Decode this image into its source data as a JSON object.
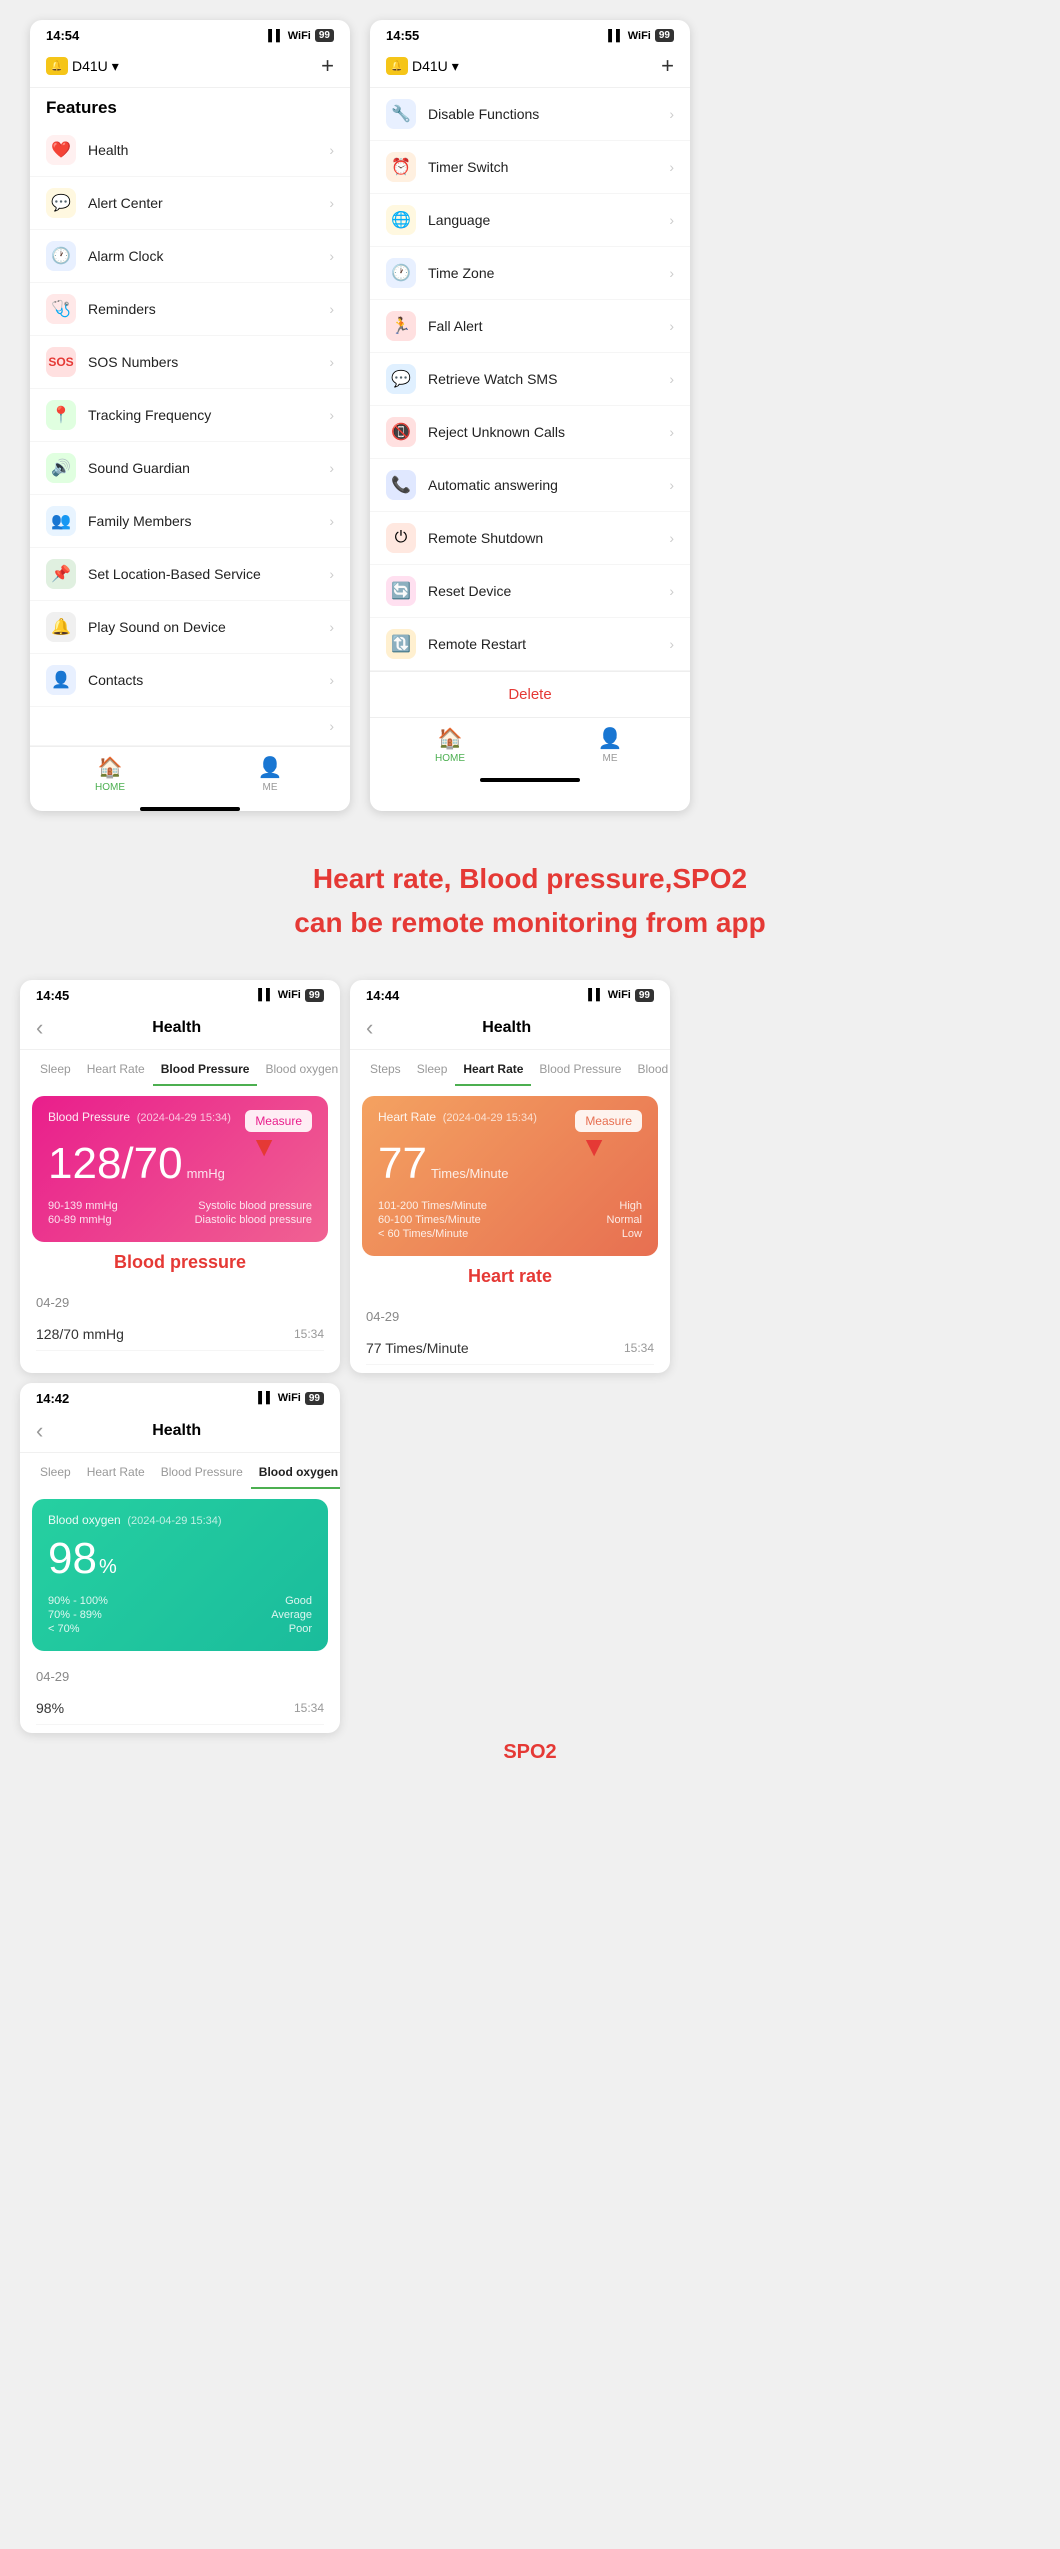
{
  "screen1": {
    "time": "14:54",
    "signal": "▌▌▌",
    "wifi": "WiFi",
    "battery": "99",
    "device": "D41U",
    "plus": "+",
    "features_title": "Features",
    "menu_items": [
      {
        "icon": "❤️",
        "icon_bg": "#fff0f0",
        "label": "Health"
      },
      {
        "icon": "💬",
        "icon_bg": "#fff8e0",
        "label": "Alert Center"
      },
      {
        "icon": "🕐",
        "icon_bg": "#e8f0ff",
        "label": "Alarm Clock"
      },
      {
        "icon": "🩺",
        "icon_bg": "#ffe8e8",
        "label": "Reminders"
      },
      {
        "icon": "🆘",
        "icon_bg": "#ffe0e0",
        "label": "SOS Numbers"
      },
      {
        "icon": "📍",
        "icon_bg": "#e0ffe0",
        "label": "Tracking Frequency"
      },
      {
        "icon": "🔊",
        "icon_bg": "#e0ffe0",
        "label": "Sound Guardian"
      },
      {
        "icon": "👨‍👩‍👧",
        "icon_bg": "#e8f4ff",
        "label": "Family Members"
      },
      {
        "icon": "📌",
        "icon_bg": "#e0f0e0",
        "label": "Set Location-Based Service"
      },
      {
        "icon": "🔔",
        "icon_bg": "#f0f0f0",
        "label": "Play Sound on Device"
      },
      {
        "icon": "👤",
        "icon_bg": "#e8f0ff",
        "label": "Contacts"
      },
      {
        "icon": "›",
        "icon_bg": "#fff",
        "label": ""
      }
    ],
    "tab_home": "HOME",
    "tab_me": "ME"
  },
  "screen2": {
    "time": "14:55",
    "signal": "▌▌▌",
    "wifi": "WiFi",
    "battery": "99",
    "device": "D41U",
    "plus": "+",
    "menu_items": [
      {
        "icon": "🔧",
        "icon_bg": "#e8f0ff",
        "label": "Disable Functions"
      },
      {
        "icon": "⏰",
        "icon_bg": "#fff0e0",
        "label": "Timer Switch"
      },
      {
        "icon": "🌐",
        "icon_bg": "#fff8e0",
        "label": "Language"
      },
      {
        "icon": "🕐",
        "icon_bg": "#e8f0ff",
        "label": "Time Zone"
      },
      {
        "icon": "🏃",
        "icon_bg": "#ffe0e0",
        "label": "Fall Alert"
      },
      {
        "icon": "💬",
        "icon_bg": "#e0f0ff",
        "label": "Retrieve Watch SMS"
      },
      {
        "icon": "📵",
        "icon_bg": "#ffe0e0",
        "label": "Reject Unknown Calls"
      },
      {
        "icon": "📞",
        "icon_bg": "#e0e8ff",
        "label": "Automatic answering"
      },
      {
        "icon": "⏻",
        "icon_bg": "#ffe8e0",
        "label": "Remote Shutdown"
      },
      {
        "icon": "🔄",
        "icon_bg": "#ffe0f0",
        "label": "Reset Device"
      },
      {
        "icon": "🔃",
        "icon_bg": "#fff0d0",
        "label": "Remote Restart"
      }
    ],
    "delete_label": "Delete",
    "tab_home": "HOME",
    "tab_me": "ME"
  },
  "description": {
    "line1": "Heart rate, Blood pressure,SPO2",
    "line2": "can be remote monitoring from app"
  },
  "health_bp": {
    "time": "14:45",
    "back": "‹",
    "title": "Health",
    "tabs": [
      "Sleep",
      "Heart Rate",
      "Blood Pressure",
      "Blood oxygen"
    ],
    "active_tab": "Blood Pressure",
    "card": {
      "title": "Blood Pressure",
      "date": "(2024-04-29 15:34)",
      "value": "128/70",
      "unit": "mmHg",
      "ranges": [
        {
          "range": "90-139 mmHg",
          "label": "Systolic blood pressure"
        },
        {
          "range": "60-89 mmHg",
          "label": "Diastolic blood pressure"
        }
      ]
    },
    "measure_btn": "Measure",
    "label": "Blood pressure",
    "history_date": "04-29",
    "history_value": "128/70 mmHg",
    "history_time": "15:34"
  },
  "health_hr": {
    "time": "14:44",
    "back": "‹",
    "title": "Health",
    "tabs": [
      "Steps",
      "Sleep",
      "Heart Rate",
      "Blood Pressure",
      "Blood o"
    ],
    "active_tab": "Heart Rate",
    "card": {
      "title": "Heart Rate",
      "date": "(2024-04-29 15:34)",
      "value": "77",
      "unit": "Times/Minute",
      "ranges": [
        {
          "range": "101-200 Times/Minute",
          "label": "High"
        },
        {
          "range": "60-100 Times/Minute",
          "label": "Normal"
        },
        {
          "range": "< 60 Times/Minute",
          "label": "Low"
        }
      ]
    },
    "measure_btn": "Measure",
    "label": "Heart rate",
    "history_date": "04-29",
    "history_value": "77 Times/Minute",
    "history_time": "15:34"
  },
  "health_spo2": {
    "time": "14:42",
    "back": "‹",
    "title": "Health",
    "tabs": [
      "Sleep",
      "Heart Rate",
      "Blood Pressure",
      "Blood oxygen"
    ],
    "active_tab": "Blood oxygen",
    "card": {
      "title": "Blood oxygen",
      "date": "(2024-04-29 15:34)",
      "value": "98",
      "unit": "%",
      "ranges": [
        {
          "range": "90% - 100%",
          "label": "Good"
        },
        {
          "range": "70% - 89%",
          "label": "Average"
        },
        {
          "range": "< 70%",
          "label": "Poor"
        }
      ]
    },
    "label": "SPO2",
    "history_date": "04-29",
    "history_value": "98%",
    "history_time": "15:34"
  }
}
